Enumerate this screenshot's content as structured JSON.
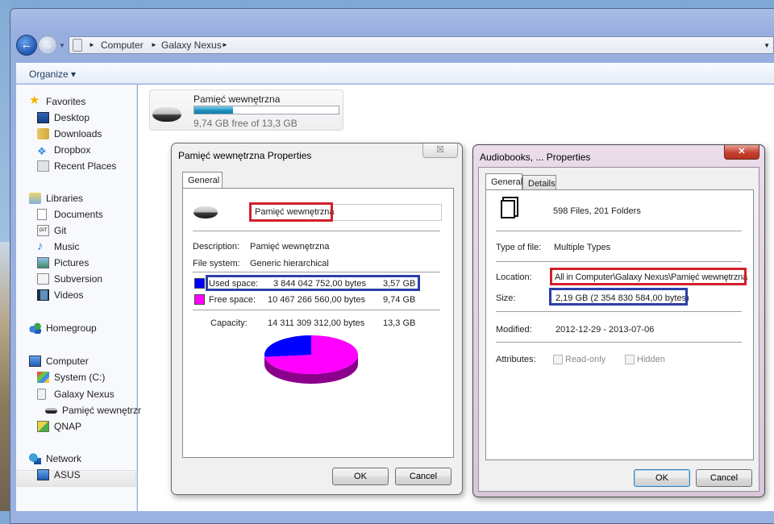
{
  "explorer": {
    "address": {
      "crumbs": [
        "Computer",
        "Galaxy Nexus"
      ],
      "icon": "phone-device-icon"
    },
    "toolbar": {
      "organize_label": "Organize ▾"
    },
    "sidebar": {
      "favorites": {
        "label": "Favorites",
        "items": [
          "Desktop",
          "Downloads",
          "Dropbox",
          "Recent Places"
        ]
      },
      "libraries": {
        "label": "Libraries",
        "items": [
          "Documents",
          "Git",
          "Music",
          "Pictures",
          "Subversion",
          "Videos"
        ]
      },
      "homegroup": {
        "label": "Homegroup"
      },
      "computer": {
        "label": "Computer",
        "items": [
          "System (C:)",
          "Galaxy Nexus",
          "Pamięć wewnętrzr",
          "QNAP"
        ],
        "selected": "Galaxy Nexus"
      },
      "network": {
        "label": "Network",
        "items": [
          "ASUS"
        ]
      }
    },
    "drive_tile": {
      "name": "Pamięć wewnętrzna",
      "free_text": "9,74 GB free of 13,3 GB",
      "used_fraction": 0.268
    }
  },
  "dialog_drive": {
    "title": "Pamięć wewnętrzna Properties",
    "close_glyph": "☒",
    "tabs": [
      "General"
    ],
    "name_value": "Pamięć wewnętrzna",
    "description_label": "Description:",
    "description_value": "Pamięć wewnętrzna",
    "fs_label": "File system:",
    "fs_value": "Generic hierarchical",
    "used": {
      "label": "Used space:",
      "bytes": "3 844 042 752,00 bytes",
      "size": "3,57 GB",
      "color": "#0000ff"
    },
    "free": {
      "label": "Free space:",
      "bytes": "10 467 266 560,00 bytes",
      "size": "9,74 GB",
      "color": "#ff00ff"
    },
    "capacity": {
      "label": "Capacity:",
      "bytes": "14 311 309 312,00 bytes",
      "size": "13,3 GB"
    },
    "pie_used_fraction": 0.2686,
    "ok_label": "OK",
    "cancel_label": "Cancel"
  },
  "dialog_folder": {
    "title": "Audiobooks, ... Properties",
    "close_glyph": "✕",
    "tabs": [
      "General",
      "Details"
    ],
    "summary": "598 Files, 201 Folders",
    "type_label": "Type of file:",
    "type_value": "Multiple Types",
    "location_label": "Location:",
    "location_value": "All in Computer\\Galaxy Nexus\\Pamięć wewnętrzna",
    "size_label": "Size:",
    "size_value": "2,19 GB (2 354 830 584,00 bytes)",
    "modified_label": "Modified:",
    "modified_value": "2012-12-29 - 2013-07-06",
    "attributes_label": "Attributes:",
    "readonly_label": "Read-only",
    "hidden_label": "Hidden",
    "ok_label": "OK",
    "cancel_label": "Cancel"
  }
}
